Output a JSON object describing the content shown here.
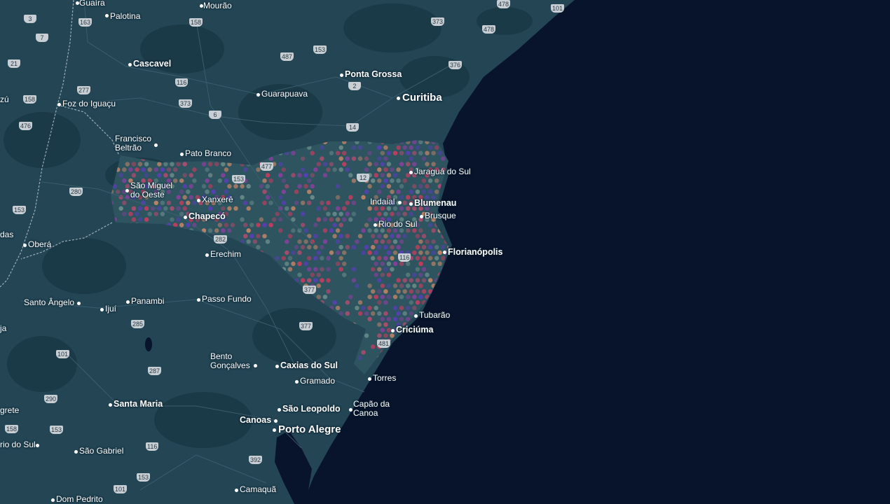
{
  "map": {
    "theme": "dark",
    "colors": {
      "ocean": "#07142b",
      "land": "#234554",
      "land_dark": "#1b3a48",
      "borders": "#b9c8d0",
      "highlight_region": "#2e5460",
      "hex_colors": [
        "#d23a5e",
        "#8a3fa0",
        "#5b3dbd",
        "#c98766",
        "#6e8f8c",
        "#b94b6e"
      ]
    },
    "cities": {
      "guaira": "Guaíra",
      "mourao": "Mourão",
      "palotina": "Palotina",
      "cascavel": "Cascavel",
      "ponta_grossa": "Ponta Grossa",
      "guarapuava": "Guarapuava",
      "curitiba": "Curitiba",
      "foz_do_iguacu": "Foz do Iguaçu",
      "zu": "zú",
      "francisco_beltrao": "Francisco\nBeltrão",
      "pato_branco": "Pato Branco",
      "jaragua_do_sul": "Jaraguá do Sul",
      "sao_miguel_do_oeste": "São Miguel\ndo Oeste",
      "xanxere": "Xanxerê",
      "chapeco": "Chapecó",
      "indaial": "Indaial",
      "blumenau": "Blumenau",
      "brusque": "Brusque",
      "rio_do_sul": "Rio do Sul",
      "florianopolis": "Florianópolis",
      "das": "das",
      "obera": "Oberá",
      "erechim": "Erechim",
      "santo_angelo": "Santo Ângelo",
      "ijui": "Ijuí",
      "panambi": "Panambi",
      "passo_fundo": "Passo Fundo",
      "tubarao": "Tubarão",
      "criciuma": "Criciúma",
      "ja": "ja",
      "bento_goncalves": "Bento\nGonçalves",
      "caxias_do_sul": "Caxias do Sul",
      "gramado": "Gramado",
      "torres": "Torres",
      "santa_maria": "Santa Maria",
      "sao_leopoldo": "São Leopoldo",
      "capao_da_canoa": "Capão da\nCanoa",
      "grete": "grete",
      "canoas": "Canoas",
      "porto_alegre": "Porto Alegre",
      "rio_do_sul_rs": "rio do Sul",
      "sao_gabriel": "São Gabriel",
      "camaqua": "Camaquã",
      "dom_pedrito": "Dom Pedrito"
    },
    "highways": [
      "478",
      "101",
      "3",
      "163",
      "158",
      "373",
      "478",
      "7",
      "487",
      "153",
      "21",
      "277",
      "116",
      "376",
      "2",
      "158",
      "373",
      "6",
      "476",
      "14",
      "280",
      "153",
      "477",
      "12",
      "153",
      "282",
      "116",
      "377",
      "285",
      "377",
      "101",
      "481",
      "287",
      "290",
      "158",
      "153",
      "116",
      "392",
      "153",
      "101"
    ]
  }
}
